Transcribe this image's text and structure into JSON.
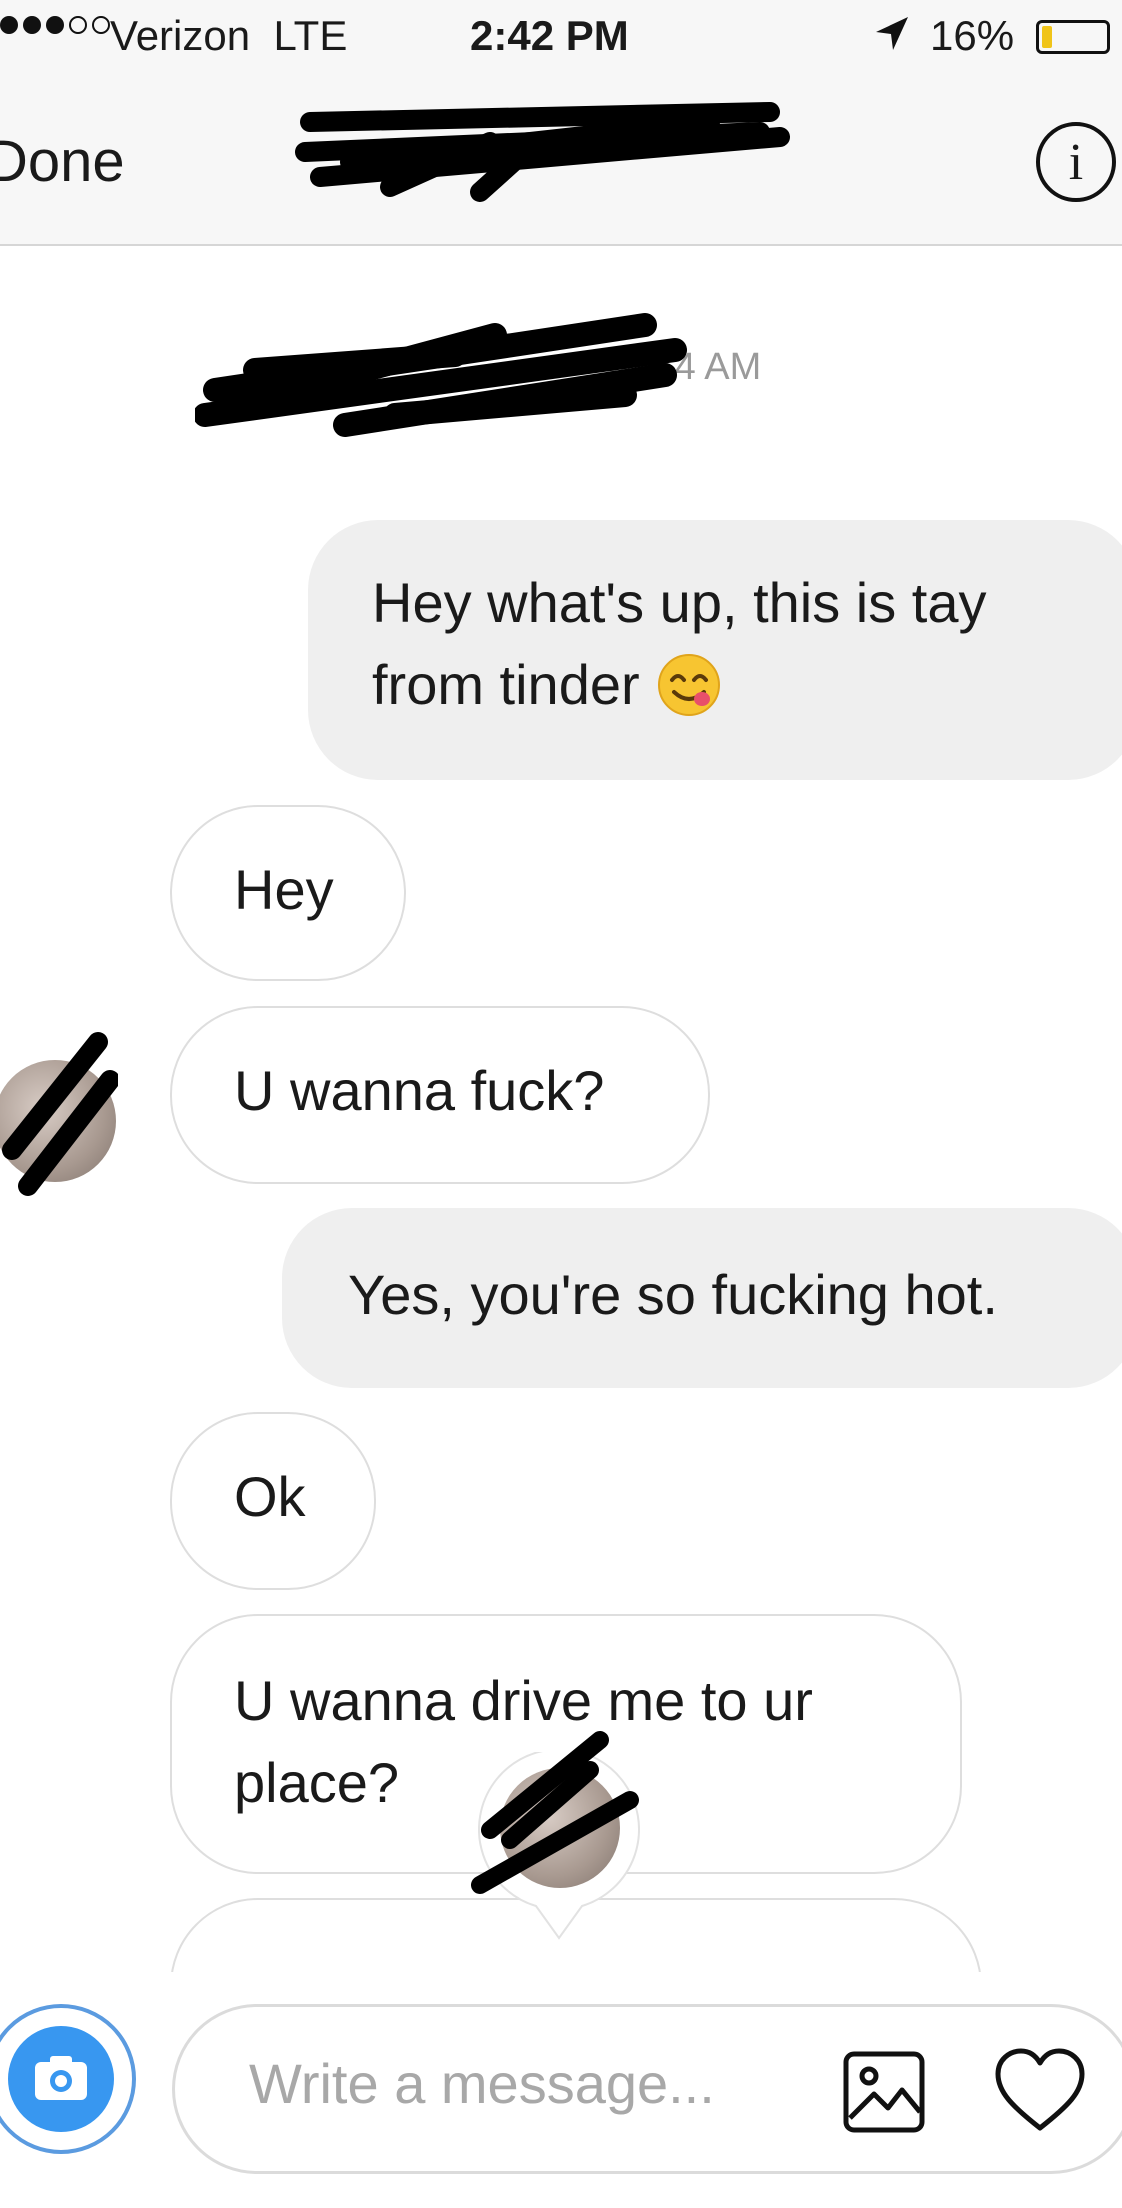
{
  "status_bar": {
    "carrier": "Verizon",
    "network": "LTE",
    "time": "2:42 PM",
    "battery_percent": "16%",
    "battery_level": 0.16,
    "signal_bars": 3,
    "icons": [
      "signal-dots-icon",
      "location-arrow-icon",
      "battery-icon"
    ]
  },
  "nav": {
    "done_label": "Done",
    "title": "",
    "title_redacted": true,
    "info_glyph": "i",
    "icons": [
      "info-icon"
    ]
  },
  "thread": {
    "timestamp": "10:54 AM",
    "messages": [
      {
        "from": "me",
        "lines": [
          "Hey what's up, this is tay",
          "from tinder"
        ],
        "emoji": "yum-face-emoji"
      },
      {
        "from": "them",
        "lines": [
          "Hey"
        ]
      },
      {
        "from": "them",
        "lines": [
          "U wanna fuck?"
        ]
      },
      {
        "from": "me",
        "lines": [
          "Yes, you're so fucking hot."
        ]
      },
      {
        "from": "them",
        "lines": [
          "Ok"
        ]
      },
      {
        "from": "them",
        "lines": [
          "U wanna drive me to ur",
          "place?"
        ]
      }
    ]
  },
  "composer": {
    "placeholder": "Write a message...",
    "icons": [
      "camera-icon",
      "gallery-icon",
      "heart-icon"
    ]
  },
  "colors": {
    "accent": "#3897f0",
    "bar_background": "#f7f7f7",
    "outgoing_bubble": "#efefef",
    "incoming_border": "#dedede",
    "timestamp_text": "#9a9a9a",
    "battery_fill": "#f0c419"
  }
}
